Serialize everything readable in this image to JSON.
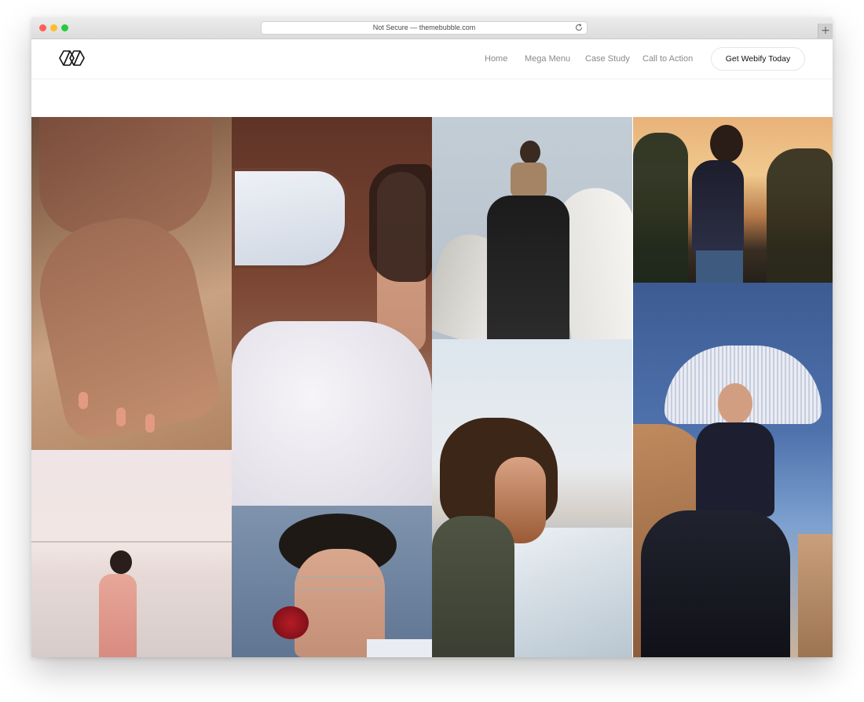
{
  "browser": {
    "url_text": "Not Secure — themebubble.com",
    "new_tab_symbol": "+"
  },
  "nav": {
    "items": [
      {
        "label": "Home"
      },
      {
        "label": "Mega Menu"
      },
      {
        "label": "Case Study"
      },
      {
        "label": "Call to Action"
      }
    ],
    "cta_label": "Get Webify Today"
  },
  "colors": {
    "traffic_red": "#fe5f57",
    "traffic_yellow": "#febc2e",
    "traffic_green": "#28c840",
    "nav_text": "#8a8a8a",
    "cta_text": "#111111"
  },
  "gallery": {
    "photos": [
      {
        "subject": "hands-in-sand"
      },
      {
        "subject": "bride-in-boat-cabin"
      },
      {
        "subject": "woman-on-concrete-structures"
      },
      {
        "subject": "woman-at-sunset"
      },
      {
        "subject": "woman-on-beach"
      },
      {
        "subject": "man-with-red-rose"
      },
      {
        "subject": "bearded-man-by-sea"
      },
      {
        "subject": "woman-with-fringe-umbrella"
      }
    ]
  }
}
